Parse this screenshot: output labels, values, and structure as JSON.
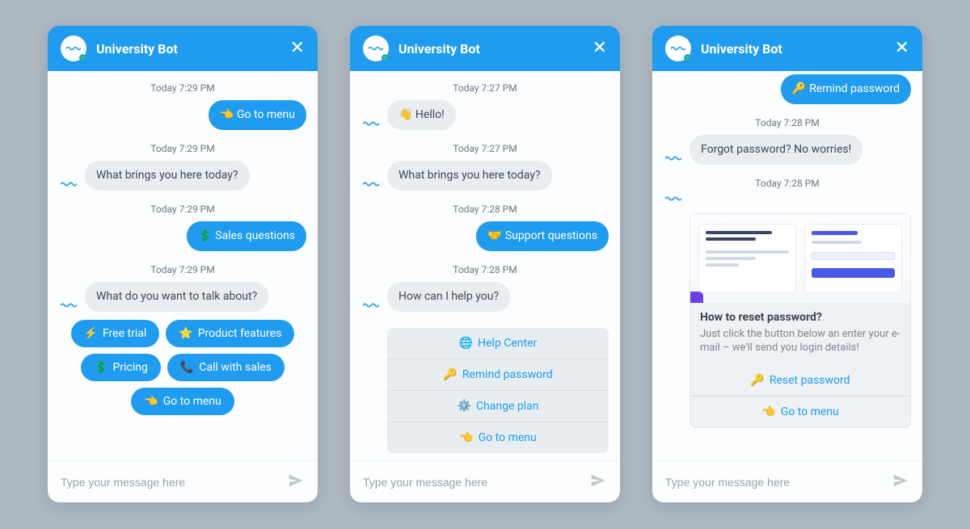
{
  "bot_name": "University Bot",
  "input_placeholder": "Type your message here",
  "panels": [
    {
      "blocks": [
        {
          "type": "ts",
          "text": "Today 7:29 PM"
        },
        {
          "type": "user",
          "emoji": "👈",
          "text": "Go to menu"
        },
        {
          "type": "ts",
          "text": "Today 7:29 PM"
        },
        {
          "type": "bot",
          "text": "What brings you here today?"
        },
        {
          "type": "ts",
          "text": "Today 7:29 PM"
        },
        {
          "type": "user",
          "emoji": "💲",
          "text": "Sales questions"
        },
        {
          "type": "ts",
          "text": "Today 7:29 PM"
        },
        {
          "type": "bot",
          "text": "What do you want to talk about?"
        },
        {
          "type": "chips",
          "items": [
            {
              "emoji": "⚡",
              "label": "Free trial"
            },
            {
              "emoji": "⭐",
              "label": "Product features"
            },
            {
              "emoji": "💲",
              "label": "Pricing"
            },
            {
              "emoji": "📞",
              "label": "Call with sales"
            },
            {
              "emoji": "👈",
              "label": "Go to menu"
            }
          ]
        }
      ]
    },
    {
      "blocks": [
        {
          "type": "ts",
          "text": "Today 7:27 PM"
        },
        {
          "type": "bot",
          "emoji": "👋",
          "text": "Hello!"
        },
        {
          "type": "ts",
          "text": "Today 7:27 PM"
        },
        {
          "type": "bot",
          "text": "What brings you here today?"
        },
        {
          "type": "ts",
          "text": "Today 7:28 PM"
        },
        {
          "type": "user",
          "emoji": "🤝",
          "text": "Support questions"
        },
        {
          "type": "ts",
          "text": "Today 7:28 PM"
        },
        {
          "type": "bot",
          "text": "How can I help you?"
        },
        {
          "type": "menu",
          "items": [
            {
              "emoji": "🌐",
              "label": "Help Center"
            },
            {
              "emoji": "🔑",
              "label": "Remind password"
            },
            {
              "emoji": "⚙️",
              "label": "Change plan"
            },
            {
              "emoji": "👈",
              "label": "Go to menu"
            }
          ]
        }
      ]
    },
    {
      "blocks": [
        {
          "type": "user",
          "emoji": "🔑",
          "text": "Remind password"
        },
        {
          "type": "ts",
          "text": "Today 7:28 PM"
        },
        {
          "type": "bot",
          "text": "Forgot password? No worries!"
        },
        {
          "type": "ts",
          "text": "Today 7:28 PM"
        },
        {
          "type": "card",
          "title": "How to reset password?",
          "desc": "Just click the button below an enter your e-mail – we'll send you login details!",
          "actions": [
            {
              "emoji": "🔑",
              "label": "Reset password"
            },
            {
              "emoji": "👈",
              "label": "Go to menu"
            }
          ]
        }
      ]
    }
  ]
}
